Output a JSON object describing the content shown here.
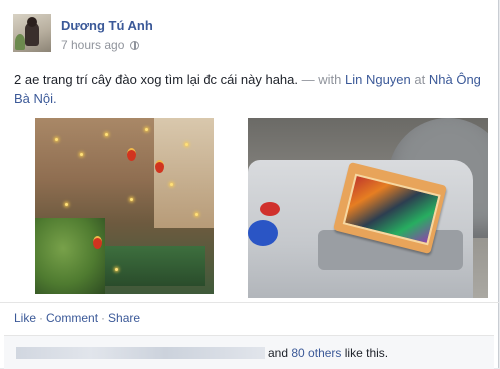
{
  "post": {
    "author": "Dương Tú Anh",
    "time": "7 hours ago",
    "privacy_icon": "globe-icon",
    "status_text": "2 ae trang trí cây đào xog tìm lại đc cái này haha.",
    "separator": "—",
    "with_label": "with",
    "tagged_person": "Lin Nguyen",
    "at_label": "at",
    "place": "Nhà Ông Bà Nội."
  },
  "actions": {
    "like": "Like",
    "comment": "Comment",
    "share": "Share",
    "dot": "·"
  },
  "likes": {
    "and": "and",
    "others_count": "80 others",
    "suffix": "like this."
  },
  "colors": {
    "link": "#3b5998",
    "muted": "#90949c",
    "background": "#e9ebee"
  }
}
